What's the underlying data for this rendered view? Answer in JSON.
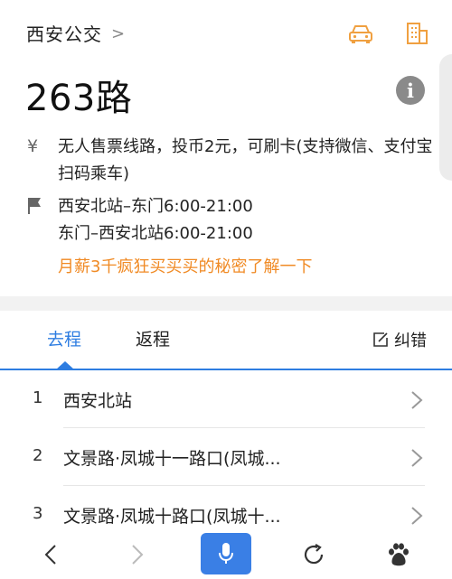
{
  "header": {
    "city": "西安公交",
    "breadcrumb_arrow": ">",
    "icons": [
      "car-icon",
      "building-icon"
    ]
  },
  "route": {
    "title": "263路",
    "info_icon": "i"
  },
  "fare": {
    "symbol": "¥",
    "text": "无人售票线路，投币2元，可刷卡(支持微信、支付宝扫码乘车)"
  },
  "hours": {
    "line1": "西安北站–东门6:00-21:00",
    "line2": "东门–西安北站6:00-21:00"
  },
  "promo": "月薪3千疯狂买买买的秘密了解一下",
  "tabs": {
    "go": "去程",
    "back": "返程",
    "report": "纠错"
  },
  "stops": [
    {
      "num": "1",
      "name": "西安北站"
    },
    {
      "num": "2",
      "name": "文景路·凤城十一路口(凤城..."
    },
    {
      "num": "3",
      "name": "文景路·凤城十路口(凤城十..."
    }
  ],
  "colors": {
    "accent_blue": "#2e7de1",
    "promo_orange": "#f08a24",
    "icon_orange": "#f0a040"
  }
}
